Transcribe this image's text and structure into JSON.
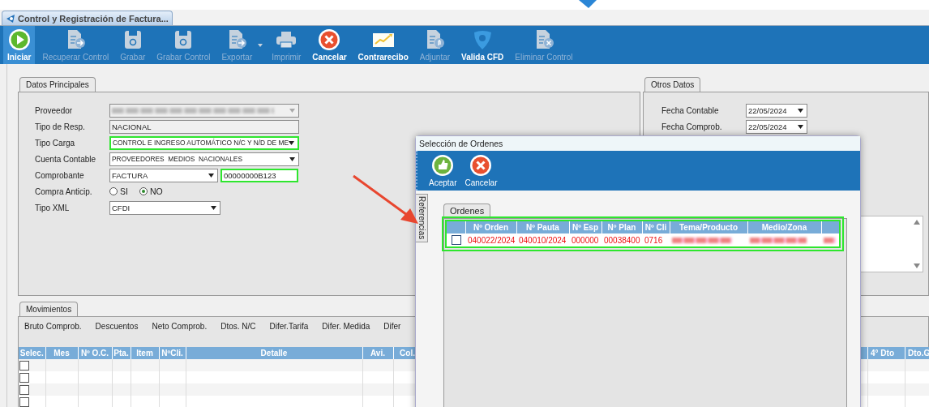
{
  "window_tab": {
    "title": "Control y Registración de Factura..."
  },
  "toolbar": [
    {
      "label": "Iniciar",
      "kind": "play",
      "disabled": false,
      "selected": true,
      "has_menu": false
    },
    {
      "label": "Recuperar Control",
      "kind": "doc-return",
      "disabled": true,
      "selected": false,
      "has_menu": false
    },
    {
      "label": "Grabar",
      "kind": "floppy",
      "disabled": true,
      "selected": false,
      "has_menu": false
    },
    {
      "label": "Grabar Control",
      "kind": "floppy",
      "disabled": true,
      "selected": false,
      "has_menu": false
    },
    {
      "label": "Exportar",
      "kind": "doc-arrow",
      "disabled": true,
      "selected": false,
      "has_menu": true
    },
    {
      "label": "Imprimir",
      "kind": "printer",
      "disabled": true,
      "selected": false,
      "has_menu": false
    },
    {
      "label": "Cancelar",
      "kind": "cancel",
      "disabled": false,
      "selected": false,
      "has_menu": false
    },
    {
      "label": "Contrarecibo",
      "kind": "chart",
      "disabled": false,
      "selected": false,
      "has_menu": false
    },
    {
      "label": "Adjuntar",
      "kind": "doc-clip",
      "disabled": true,
      "selected": false,
      "has_menu": false
    },
    {
      "label": "Valida CFD",
      "kind": "badge",
      "disabled": false,
      "selected": false,
      "has_menu": false
    },
    {
      "label": "Eliminar Control",
      "kind": "doc-x",
      "disabled": true,
      "selected": false,
      "has_menu": false
    }
  ],
  "datos_principales": {
    "tab": "Datos Principales",
    "fields": [
      {
        "label": "Proveedor",
        "kind": "redacted-combo",
        "highlighted": false
      },
      {
        "label": "Tipo de Resp.",
        "kind": "text",
        "value": "NACIONAL",
        "highlighted": false
      },
      {
        "label": "Tipo Carga",
        "kind": "combo",
        "value": "CONTROL E INGRESO AUTOMÁTICO N/C Y N/D DE ME",
        "highlighted": true
      },
      {
        "label": "Cuenta Contable",
        "kind": "combo",
        "value": "PROVEEDORES  MEDIOS  NACIONALES",
        "highlighted": false
      },
      {
        "label": "Comprobante",
        "kind": "combo-number",
        "value": "FACTURA",
        "highlighted": false,
        "number": {
          "value": "00000000B123",
          "highlighted": true
        }
      },
      {
        "label": "Compra Anticip.",
        "kind": "radio",
        "highlighted": false,
        "options": [
          {
            "label": "SI",
            "selected": false
          },
          {
            "label": "NO",
            "selected": true
          }
        ]
      },
      {
        "label": "Tipo XML",
        "kind": "short-combo",
        "value": "CFDI",
        "highlighted": false
      }
    ]
  },
  "otros_datos": {
    "tab": "Otros Datos",
    "fields": [
      {
        "label": "Fecha Contable",
        "value": "22/05/2024"
      },
      {
        "label": "Fecha Comprob.",
        "value": "22/05/2024"
      }
    ]
  },
  "movimientos": {
    "tab": "Movimientos",
    "totals": [
      "Bruto Comprob.",
      "Descuentos",
      "Neto Comprob.",
      "Dtos. N/C",
      "Difer.Tarifa",
      "Difer. Medida",
      "Difer"
    ],
    "columns": [
      "Selec.",
      "Mes",
      "Nº O.C.",
      "Pta.",
      "Item",
      "NºCli.",
      "Detalle",
      "Avi.",
      "Col."
    ],
    "right_columns": [
      "4° Dto",
      "Dto.G"
    ],
    "rows": [
      {
        "checked": false
      },
      {
        "checked": false
      },
      {
        "checked": false
      },
      {
        "checked": false
      }
    ]
  },
  "dialog": {
    "title": "Selección de Ordenes",
    "buttons": [
      {
        "label": "Aceptar",
        "kind": "accept"
      },
      {
        "label": "Cancelar",
        "kind": "cancel"
      }
    ],
    "side_tab": "Referencias",
    "tab": "Ordenes",
    "highlighted": true,
    "columns": [
      "Nº Orden",
      "Nº Pauta",
      "Nº Esp",
      "Nº Plan",
      "Nº Cli",
      "Tema/Producto",
      "Medio/Zona"
    ],
    "rows": [
      {
        "checked": false,
        "cells": [
          "040022/2024",
          "040010/2024",
          "000000",
          "00038400",
          "0716"
        ]
      }
    ]
  }
}
